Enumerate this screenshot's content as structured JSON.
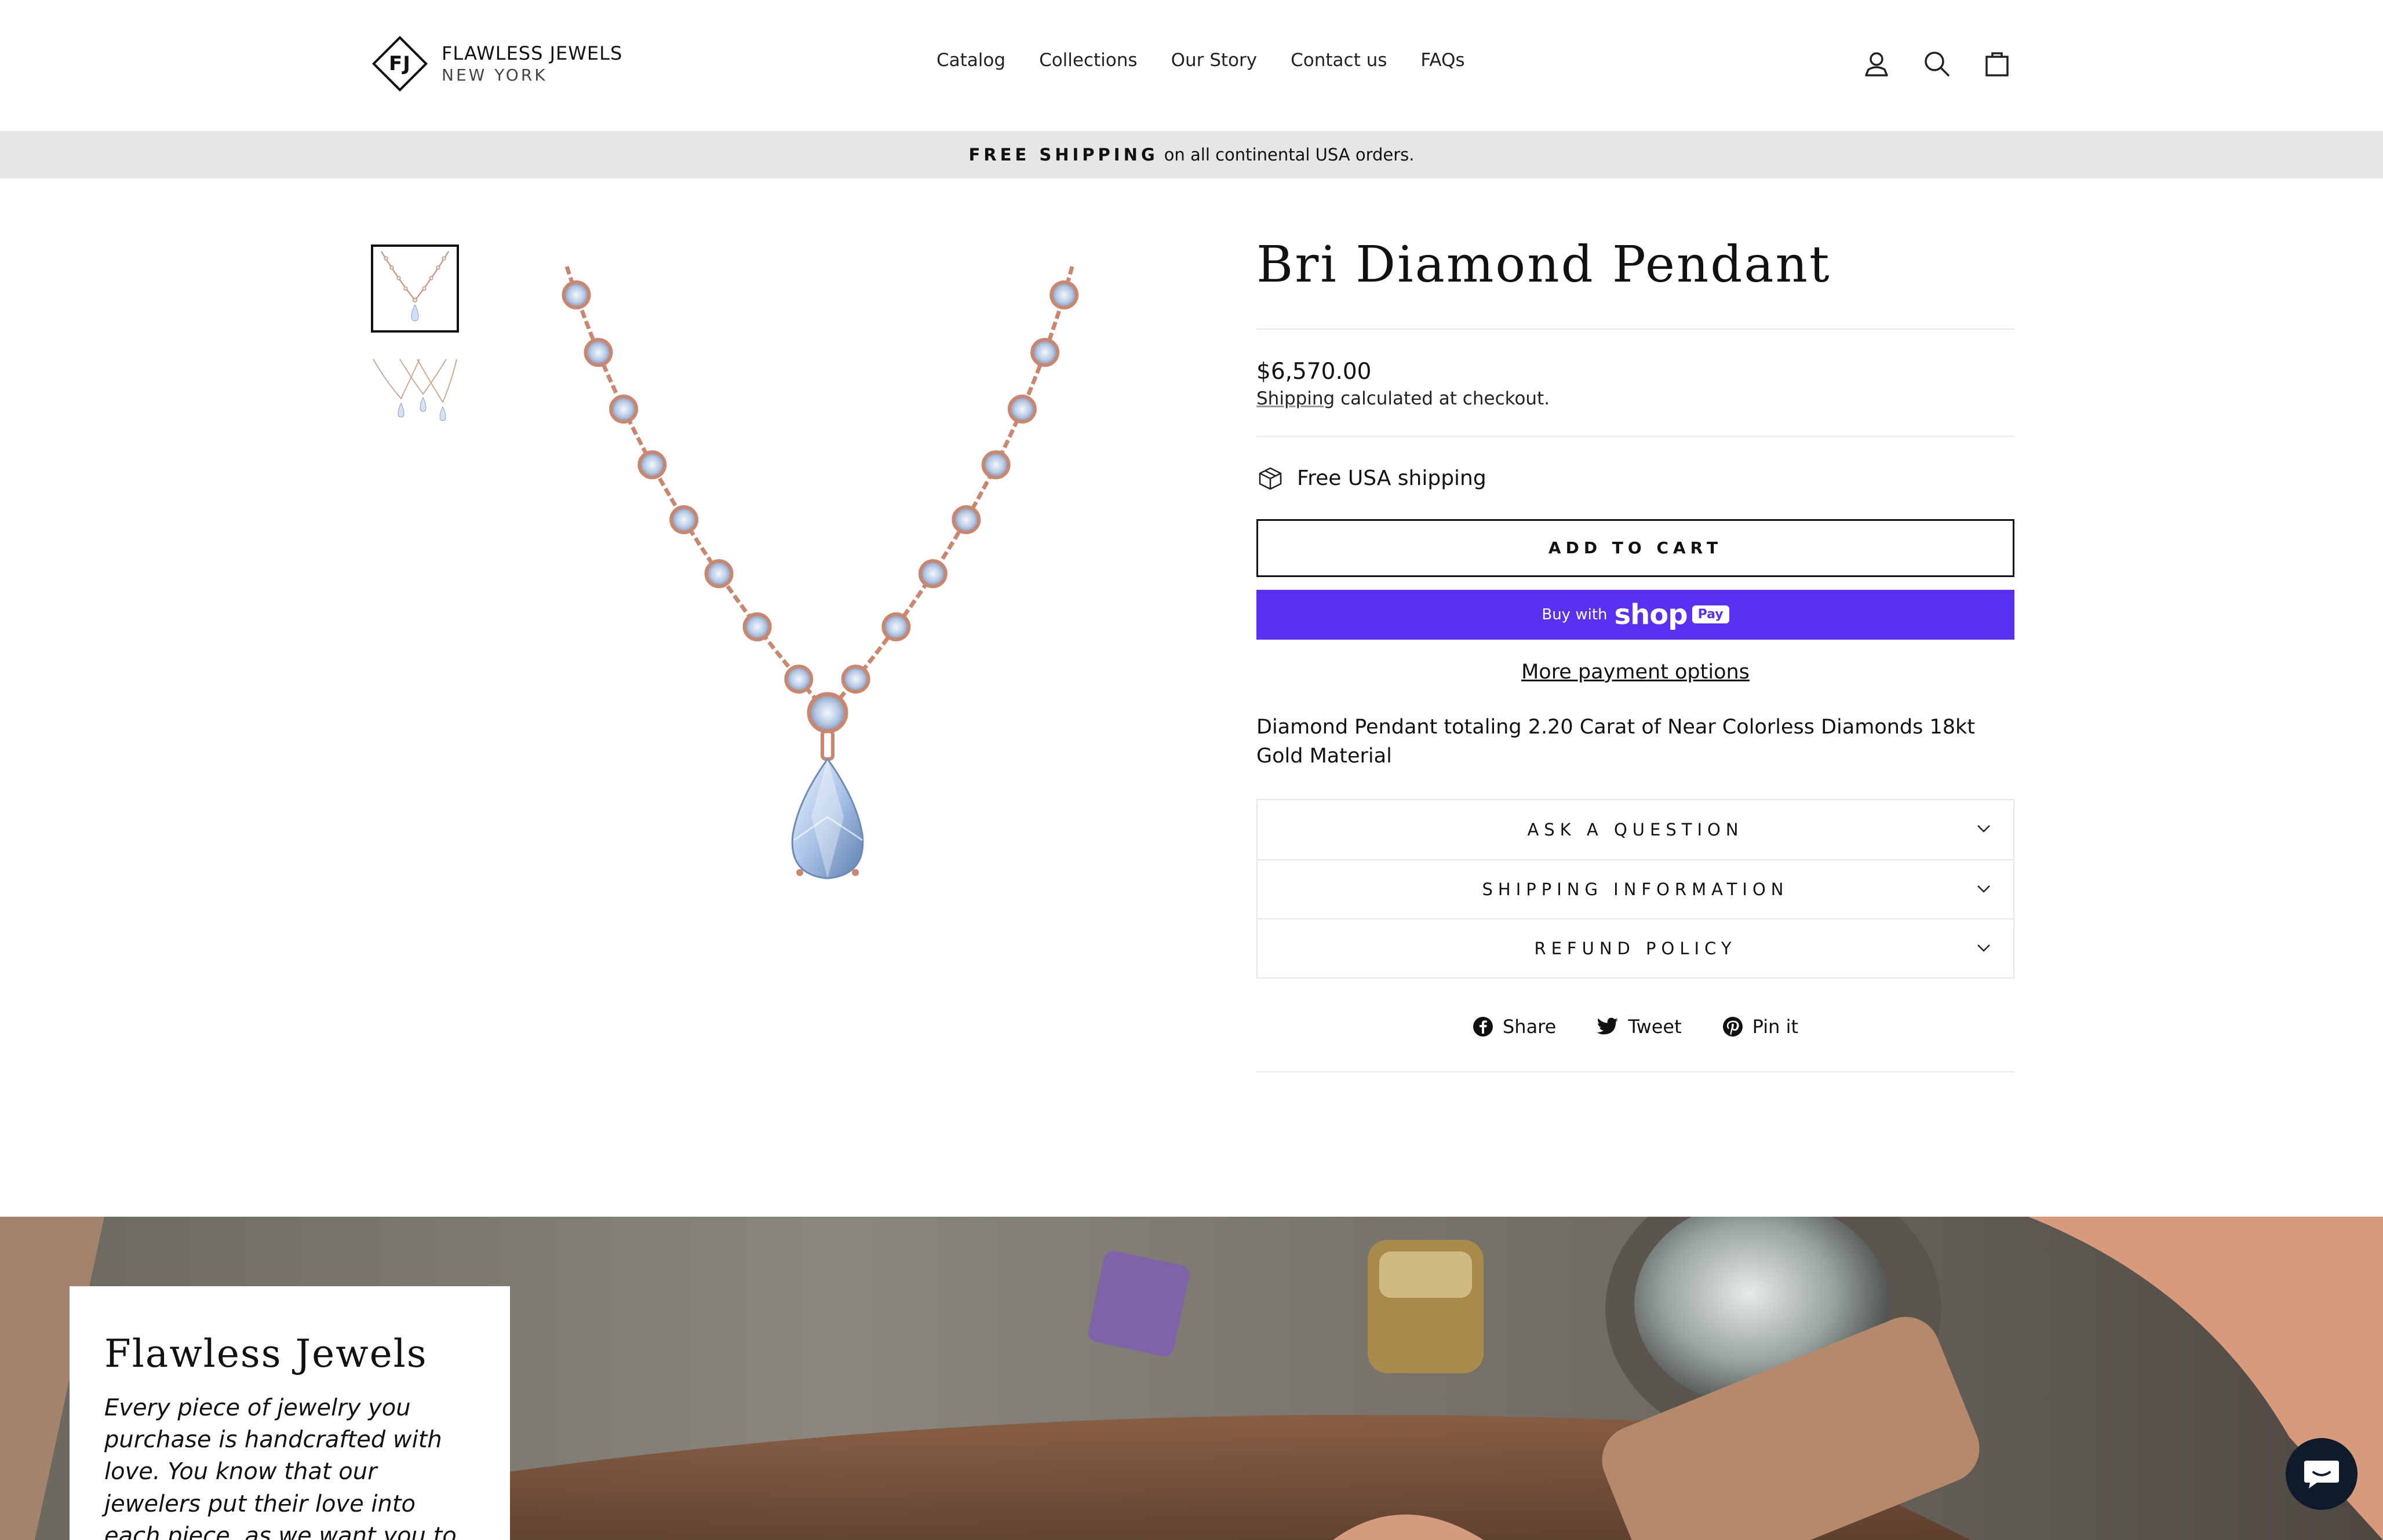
{
  "header": {
    "logo_monogram": "FJ",
    "logo_line1": "FLAWLESS JEWELS",
    "logo_line2": "NEW YORK",
    "nav": [
      "Catalog",
      "Collections",
      "Our Story",
      "Contact us",
      "FAQs"
    ],
    "icons": [
      "account-icon",
      "search-icon",
      "cart-icon"
    ]
  },
  "announcement": {
    "bold": "FREE SHIPPING",
    "text": "on all continental USA orders."
  },
  "product": {
    "title": "Bri Diamond Pendant",
    "price": "$6,570.00",
    "shipping_link": "Shipping",
    "shipping_rest": " calculated at checkout.",
    "free_shipping": "Free USA shipping",
    "add_to_cart": "ADD TO CART",
    "shop_pay_prefix": "Buy with",
    "shop_pay_brand": "shop",
    "shop_pay_badge": "Pay",
    "more_payment": "More payment options",
    "description": "Diamond Pendant totaling 2.20 Carat of Near Colorless Diamonds 18kt Gold Material",
    "accordion": [
      "ASK A QUESTION",
      "SHIPPING INFORMATION",
      "REFUND POLICY"
    ],
    "social": [
      "Share",
      "Tweet",
      "Pin it"
    ]
  },
  "hero": {
    "title": "Flawless Jewels",
    "text": "Every piece of jewelry you purchase is handcrafted with love. You know that our jewelers put their love into each piece, as we want you to look beautiful."
  },
  "colors": {
    "accent": "#5a31f4",
    "chain": "#c8876e",
    "announcement_bg": "#e6e6e6"
  }
}
